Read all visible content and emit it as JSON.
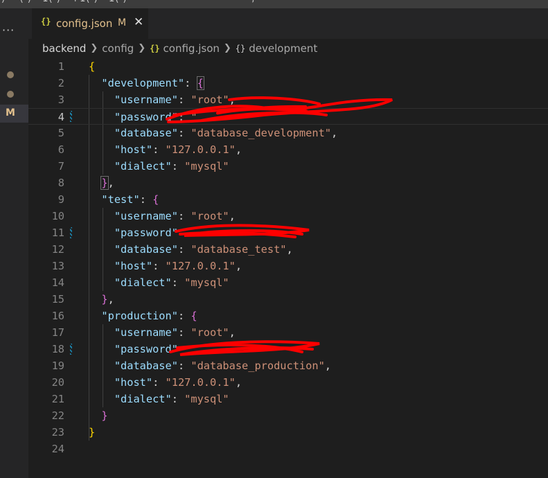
{
  "tab": {
    "icon": "{}",
    "filename": "config.json",
    "status": "M"
  },
  "activity": {
    "more": "···",
    "badge": "M"
  },
  "breadcrumb": {
    "items": [
      "backend",
      "config",
      "config.json",
      "development"
    ],
    "file_icon": "{}",
    "object_icon": "{}"
  },
  "lines": [
    {
      "n": "1"
    },
    {
      "n": "2"
    },
    {
      "n": "3"
    },
    {
      "n": "4"
    },
    {
      "n": "5"
    },
    {
      "n": "6"
    },
    {
      "n": "7"
    },
    {
      "n": "8"
    },
    {
      "n": "9"
    },
    {
      "n": "10"
    },
    {
      "n": "11"
    },
    {
      "n": "12"
    },
    {
      "n": "13"
    },
    {
      "n": "14"
    },
    {
      "n": "15"
    },
    {
      "n": "16"
    },
    {
      "n": "17"
    },
    {
      "n": "18"
    },
    {
      "n": "19"
    },
    {
      "n": "20"
    },
    {
      "n": "21"
    },
    {
      "n": "22"
    },
    {
      "n": "23"
    },
    {
      "n": "24"
    }
  ],
  "config": {
    "development": {
      "key": "\"development\"",
      "username": "\"root\"",
      "database": "\"database_development\"",
      "host": "\"127.0.0.1\"",
      "dialect": "\"mysql\""
    },
    "test": {
      "key": "\"test\"",
      "username": "\"root\"",
      "database": "\"database_test\"",
      "host": "\"127.0.0.1\"",
      "dialect": "\"mysql\""
    },
    "production": {
      "key": "\"production\"",
      "username": "\"root\"",
      "database": "\"database_production\"",
      "host": "\"127.0.0.1\"",
      "dialect": "\"mysql\""
    }
  },
  "keys": {
    "username": "\"username\"",
    "password": "\"password\"",
    "database": "\"database\"",
    "host": "\"host\"",
    "dialect": "\"dialect\""
  },
  "colors": {
    "brace": "#ffd700",
    "inner_brace": "#da70d6",
    "key": "#9cdcfe",
    "string": "#ce9178",
    "redaction": "#ff0000",
    "modified": "#e2c08d"
  }
}
